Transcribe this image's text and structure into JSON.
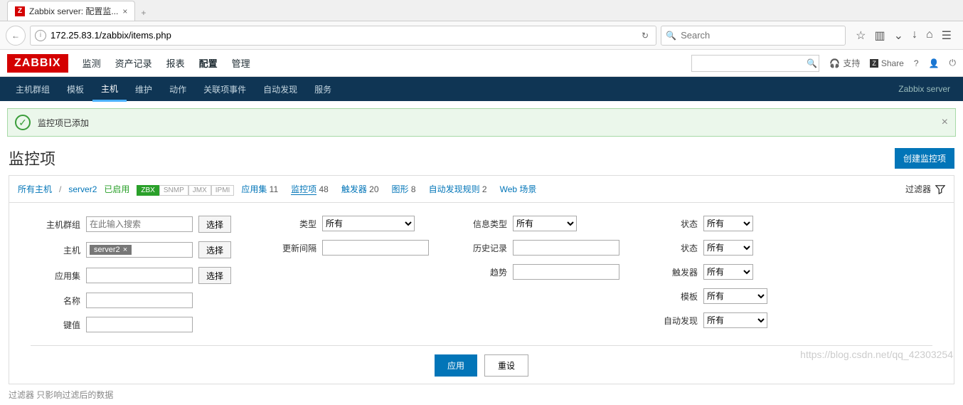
{
  "browser": {
    "tab_title": "Zabbix server: 配置监...",
    "url_prefix": "172.25.83.1",
    "url_path": "/zabbix/items.php",
    "search_placeholder": "Search"
  },
  "header": {
    "logo": "ZABBIX",
    "nav": [
      "监测",
      "资产记录",
      "报表",
      "配置",
      "管理"
    ],
    "nav_active_index": 3,
    "support": "支持",
    "share": "Share"
  },
  "subnav": {
    "items": [
      "主机群组",
      "模板",
      "主机",
      "维护",
      "动作",
      "关联项事件",
      "自动发现",
      "服务"
    ],
    "active_index": 2,
    "right": "Zabbix server"
  },
  "message": "监控项已添加",
  "page_title": "监控项",
  "create_button": "创建监控项",
  "crumb": {
    "all_hosts": "所有主机",
    "host": "server2",
    "enabled": "已启用",
    "badges": [
      "ZBX",
      "SNMP",
      "JMX",
      "IPMI"
    ],
    "links": [
      {
        "label": "应用集",
        "count": "11"
      },
      {
        "label": "监控项",
        "count": "48"
      },
      {
        "label": "触发器",
        "count": "20"
      },
      {
        "label": "图形",
        "count": "8"
      },
      {
        "label": "自动发现规则",
        "count": "2"
      },
      {
        "label": "Web 场景",
        "count": ""
      }
    ],
    "active_link_index": 1,
    "filter_label": "过滤器"
  },
  "filter": {
    "col1": {
      "host_group_label": "主机群组",
      "host_group_placeholder": "在此输入搜索",
      "host_label": "主机",
      "host_tag": "server2",
      "app_set_label": "应用集",
      "name_label": "名称",
      "key_label": "键值",
      "select_btn": "选择"
    },
    "col2": {
      "type_label": "类型",
      "type_value": "所有",
      "interval_label": "更新间隔"
    },
    "col3": {
      "info_type_label": "信息类型",
      "info_type_value": "所有",
      "history_label": "历史记录",
      "trend_label": "趋势"
    },
    "col4": {
      "state_label": "状态",
      "state_value": "所有",
      "status_label": "状态",
      "status_value": "所有",
      "trigger_label": "触发器",
      "trigger_value": "所有",
      "template_label": "模板",
      "template_value": "所有",
      "discovery_label": "自动发现",
      "discovery_value": "所有"
    },
    "apply": "应用",
    "reset": "重设"
  },
  "footer_note": "过滤器 只影响过滤后的数据",
  "watermark": "https://blog.csdn.net/qq_42303254"
}
